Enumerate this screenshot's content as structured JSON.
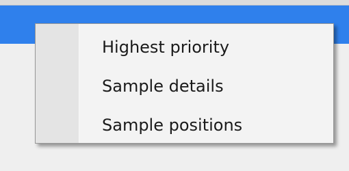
{
  "context_menu": {
    "items": [
      {
        "label": "Highest priority"
      },
      {
        "label": "Sample details"
      },
      {
        "label": "Sample positions"
      }
    ]
  },
  "colors": {
    "title_bar": "#2f80ec",
    "menu_background": "#f3f3f3",
    "menu_gutter": "#e4e4e4",
    "window_background": "#efefef"
  }
}
